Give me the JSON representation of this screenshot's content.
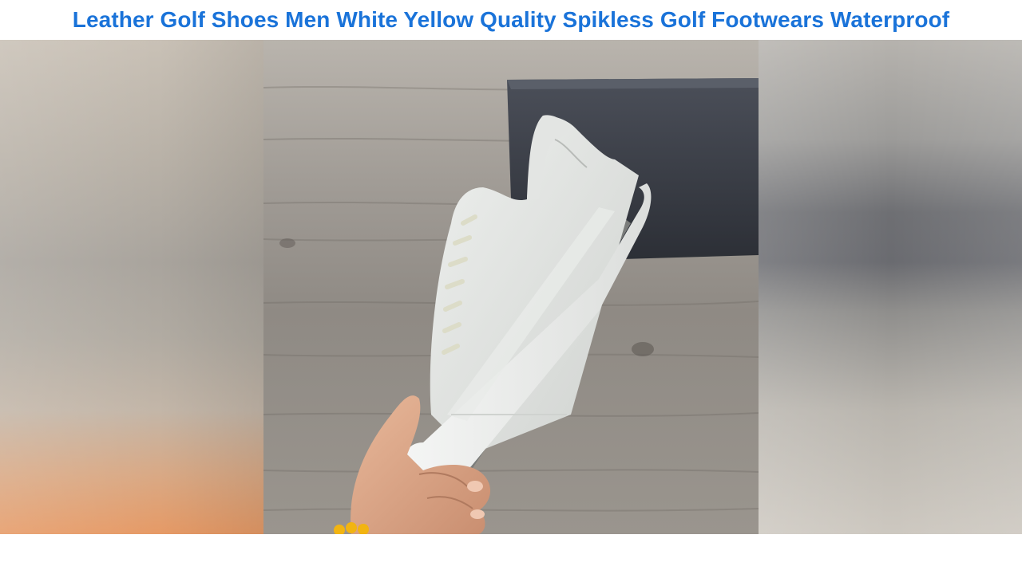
{
  "video": {
    "title": "Leather Golf Shoes Men White Yellow Quality Spikless Golf Footwears Waterproof"
  },
  "frame": {
    "content": "product-photo",
    "subject_icon": "shoe-icon"
  },
  "colors": {
    "title": "#1a73d9",
    "background": "#ffffff"
  }
}
